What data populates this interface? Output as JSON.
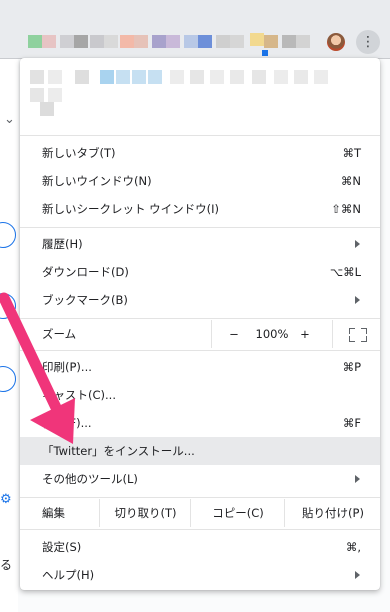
{
  "browser": {
    "toolbar_color_squares": [
      "#8fd19e",
      "#e7c4c4",
      "#cfcfd3",
      "#a6a6a6",
      "#c9c9cd",
      "#d9d9d9",
      "#f3b9a8",
      "#e6c2b8",
      "#a8a2cc",
      "#c9b9d9",
      "#b8c8e6",
      "#6d8fd9",
      "#cfcfcf",
      "#d6d6d6",
      "#f2d98f",
      "#d6b78a",
      "#b9b9b9",
      "#d3d3d3"
    ],
    "active_indicator_color": "#1a73e8"
  },
  "menu": {
    "new_tab": {
      "label": "新しいタブ(T)",
      "shortcut": "⌘T"
    },
    "new_window": {
      "label": "新しいウインドウ(N)",
      "shortcut": "⌘N"
    },
    "new_incognito": {
      "label": "新しいシークレット ウインドウ(I)",
      "shortcut": "⇧⌘N"
    },
    "history": {
      "label": "履歴(H)"
    },
    "downloads": {
      "label": "ダウンロード(D)",
      "shortcut": "⌥⌘L"
    },
    "bookmarks": {
      "label": "ブックマーク(B)"
    },
    "zoom": {
      "label": "ズーム",
      "minus": "−",
      "value": "100%",
      "plus": "+"
    },
    "print": {
      "label": "印刷(P)...",
      "shortcut": "⌘P"
    },
    "cast": {
      "label": "キャスト(C)..."
    },
    "find": {
      "label": "検索(F)...",
      "shortcut": "⌘F"
    },
    "install": {
      "label": "「Twitter」をインストール..."
    },
    "more_tools": {
      "label": "その他のツール(L)"
    },
    "edit": {
      "label": "編集",
      "cut": "切り取り(T)",
      "copy": "コピー(C)",
      "paste": "貼り付け(P)"
    },
    "settings": {
      "label": "設定(S)",
      "shortcut": "⌘,"
    },
    "help": {
      "label": "ヘルプ(H)"
    }
  },
  "page": {
    "partial_text": "る"
  },
  "annotation": {
    "arrow_color": "#f0357a"
  }
}
